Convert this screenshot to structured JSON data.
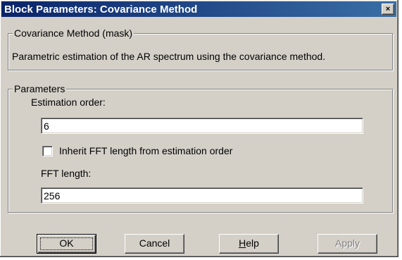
{
  "window": {
    "title": "Block Parameters: Covariance Method",
    "close_glyph": "×"
  },
  "description": {
    "group_label": "Covariance Method (mask)",
    "text": "Parametric estimation of the AR spectrum using the covariance method."
  },
  "parameters": {
    "group_label": "Parameters",
    "estimation_order": {
      "label": "Estimation order:",
      "value": "6"
    },
    "inherit_fft": {
      "label": "Inherit FFT length from estimation order",
      "checked": false
    },
    "fft_length": {
      "label": "FFT length:",
      "value": "256"
    }
  },
  "buttons": {
    "ok": {
      "label": "OK",
      "enabled": true
    },
    "cancel": {
      "label": "Cancel",
      "enabled": true
    },
    "help": {
      "label": "Help",
      "mnemonic_underline": "H",
      "enabled": true
    },
    "apply": {
      "label": "Apply",
      "enabled": false
    }
  },
  "colors": {
    "dialog_face": "#d4d0c8",
    "title_gradient_start": "#0a246a",
    "title_gradient_end": "#3a6ea5",
    "disabled_text": "#808080"
  }
}
